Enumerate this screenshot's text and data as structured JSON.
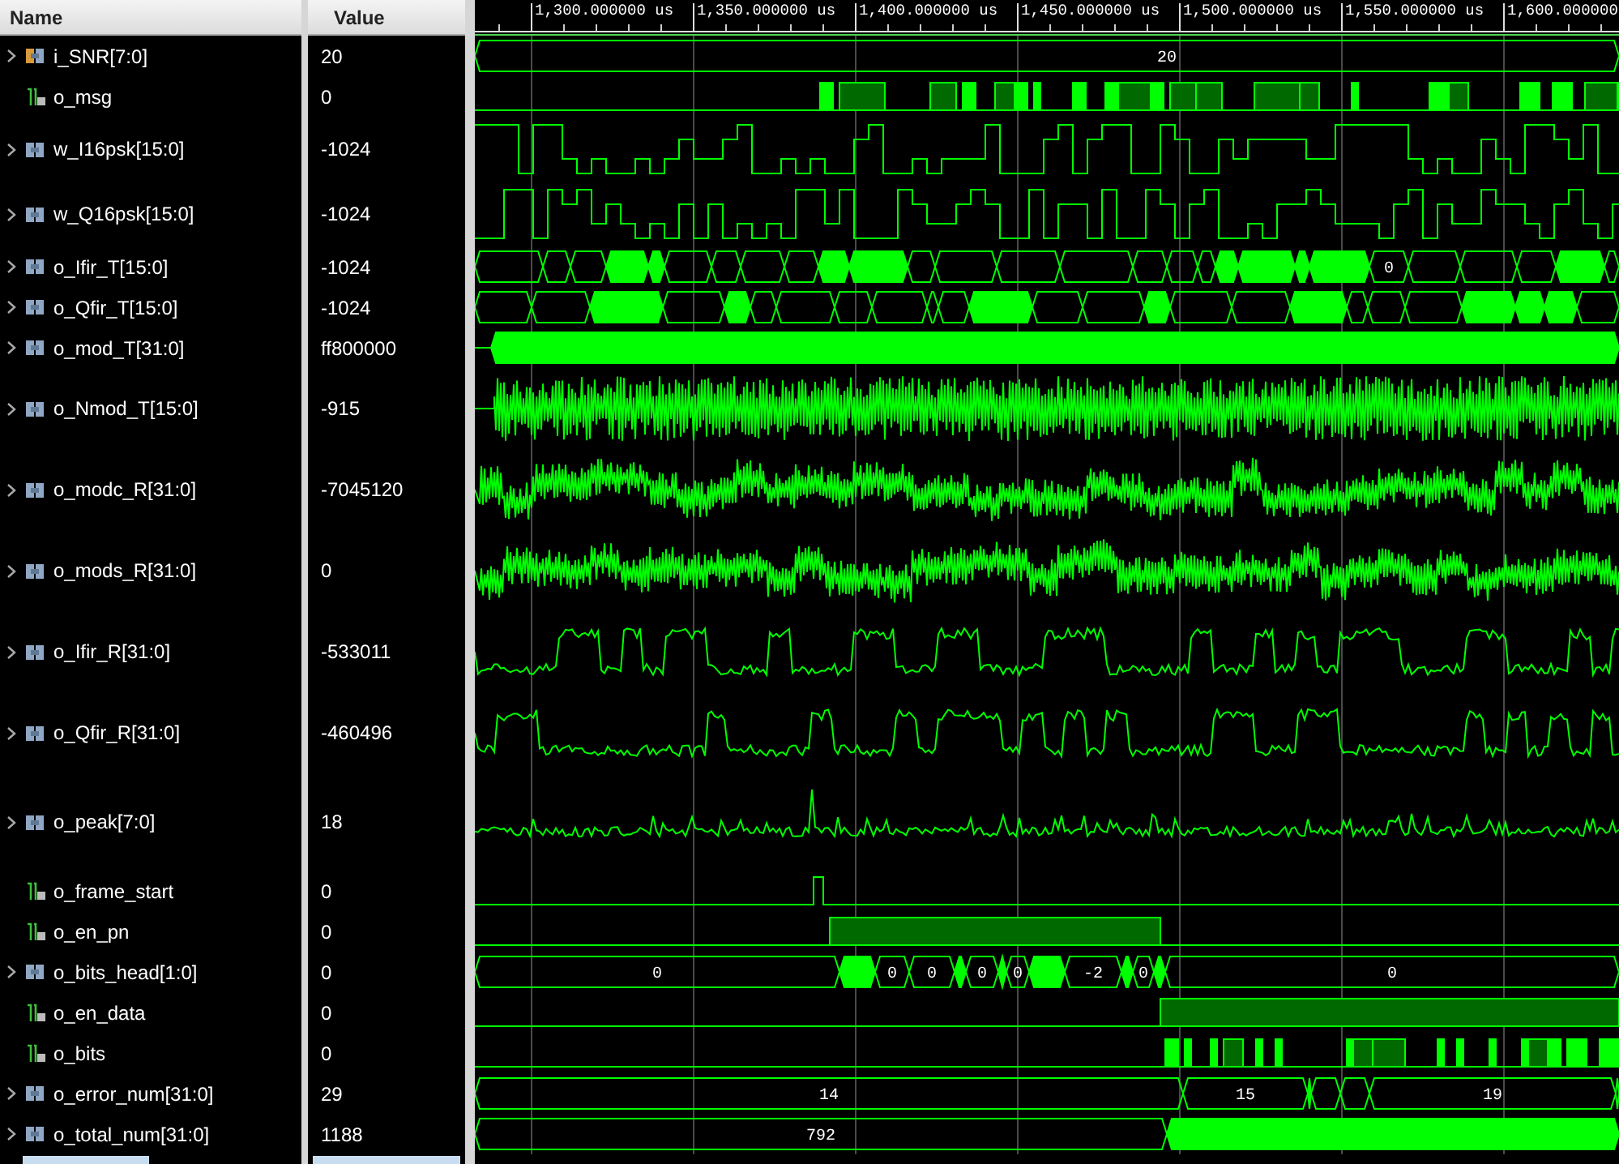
{
  "columns": {
    "name": "Name",
    "value": "Value"
  },
  "time_axis": {
    "ticks": [
      "1,300.000000 us",
      "1,350.000000 us",
      "1,400.000000 us",
      "1,450.000000 us",
      "1,500.000000 us",
      "1,550.000000 us",
      "1,600.000000"
    ]
  },
  "signals": [
    {
      "name": "i_SNR[7:0]",
      "value": "20",
      "kind": "bus",
      "wave": {
        "kind": "level",
        "labels": [
          "20"
        ]
      }
    },
    {
      "name": "o_msg",
      "value": "0",
      "kind": "bit",
      "wave": {
        "kind": "bits"
      }
    },
    {
      "name": "w_I16psk[15:0]",
      "value": "-1024",
      "kind": "bus",
      "wave": {
        "kind": "square"
      }
    },
    {
      "name": "w_Q16psk[15:0]",
      "value": "-1024",
      "kind": "bus",
      "wave": {
        "kind": "square"
      }
    },
    {
      "name": "o_Ifir_T[15:0]",
      "value": "-1024",
      "kind": "bus",
      "wave": {
        "kind": "busdense",
        "labels": [
          "0"
        ]
      }
    },
    {
      "name": "o_Qfir_T[15:0]",
      "value": "-1024",
      "kind": "bus",
      "wave": {
        "kind": "busdense"
      }
    },
    {
      "name": "o_mod_T[31:0]",
      "value": "ff800000",
      "kind": "bus",
      "wave": {
        "kind": "filled"
      }
    },
    {
      "name": "o_Nmod_T[15:0]",
      "value": "-915",
      "kind": "bus",
      "wave": {
        "kind": "noise"
      }
    },
    {
      "name": "o_modc_R[31:0]",
      "value": "-7045120",
      "kind": "bus",
      "wave": {
        "kind": "burst"
      }
    },
    {
      "name": "o_mods_R[31:0]",
      "value": "0",
      "kind": "bus",
      "wave": {
        "kind": "burst"
      }
    },
    {
      "name": "o_Ifir_R[31:0]",
      "value": "-533011",
      "kind": "bus",
      "wave": {
        "kind": "analog"
      }
    },
    {
      "name": "o_Qfir_R[31:0]",
      "value": "-460496",
      "kind": "bus",
      "wave": {
        "kind": "analog"
      }
    },
    {
      "name": "o_peak[7:0]",
      "value": "18",
      "kind": "bus",
      "wave": {
        "kind": "spiky"
      }
    },
    {
      "name": "o_frame_start",
      "value": "0",
      "kind": "bit",
      "wave": {
        "kind": "pulse"
      }
    },
    {
      "name": "o_en_pn",
      "value": "0",
      "kind": "bit",
      "wave": {
        "kind": "enable"
      }
    },
    {
      "name": "o_bits_head[1:0]",
      "value": "0",
      "kind": "bus",
      "wave": {
        "kind": "bus",
        "segments": [
          {
            "kind": "value",
            "text": "0"
          },
          {
            "kind": "dense"
          },
          {
            "kind": "value",
            "text": "0"
          },
          {
            "kind": "value",
            "text": "0"
          },
          {
            "kind": "dense"
          },
          {
            "kind": "value",
            "text": "0"
          },
          {
            "kind": "dense"
          },
          {
            "kind": "value",
            "text": "0"
          },
          {
            "kind": "dense"
          },
          {
            "kind": "value",
            "text": "-2"
          },
          {
            "kind": "dense"
          },
          {
            "kind": "value",
            "text": "0"
          },
          {
            "kind": "dense"
          },
          {
            "kind": "value",
            "text": "0"
          }
        ]
      }
    },
    {
      "name": "o_en_data",
      "value": "0",
      "kind": "bit",
      "wave": {
        "kind": "enable"
      }
    },
    {
      "name": "o_bits",
      "value": "0",
      "kind": "bit",
      "wave": {
        "kind": "bits"
      }
    },
    {
      "name": "o_error_num[31:0]",
      "value": "29",
      "kind": "bus",
      "wave": {
        "kind": "bus",
        "segments": [
          {
            "kind": "value",
            "text": "14"
          },
          {
            "kind": "value",
            "text": "15"
          },
          {
            "kind": "dense"
          },
          {
            "kind": "blank"
          },
          {
            "kind": "blank"
          },
          {
            "kind": "value",
            "text": "19"
          },
          {
            "kind": "blank"
          }
        ]
      }
    },
    {
      "name": "o_total_num[31:0]",
      "value": "1188",
      "kind": "bus",
      "wave": {
        "kind": "bus",
        "segments": [
          {
            "kind": "value",
            "text": "792"
          },
          {
            "kind": "dense"
          }
        ]
      }
    }
  ]
}
